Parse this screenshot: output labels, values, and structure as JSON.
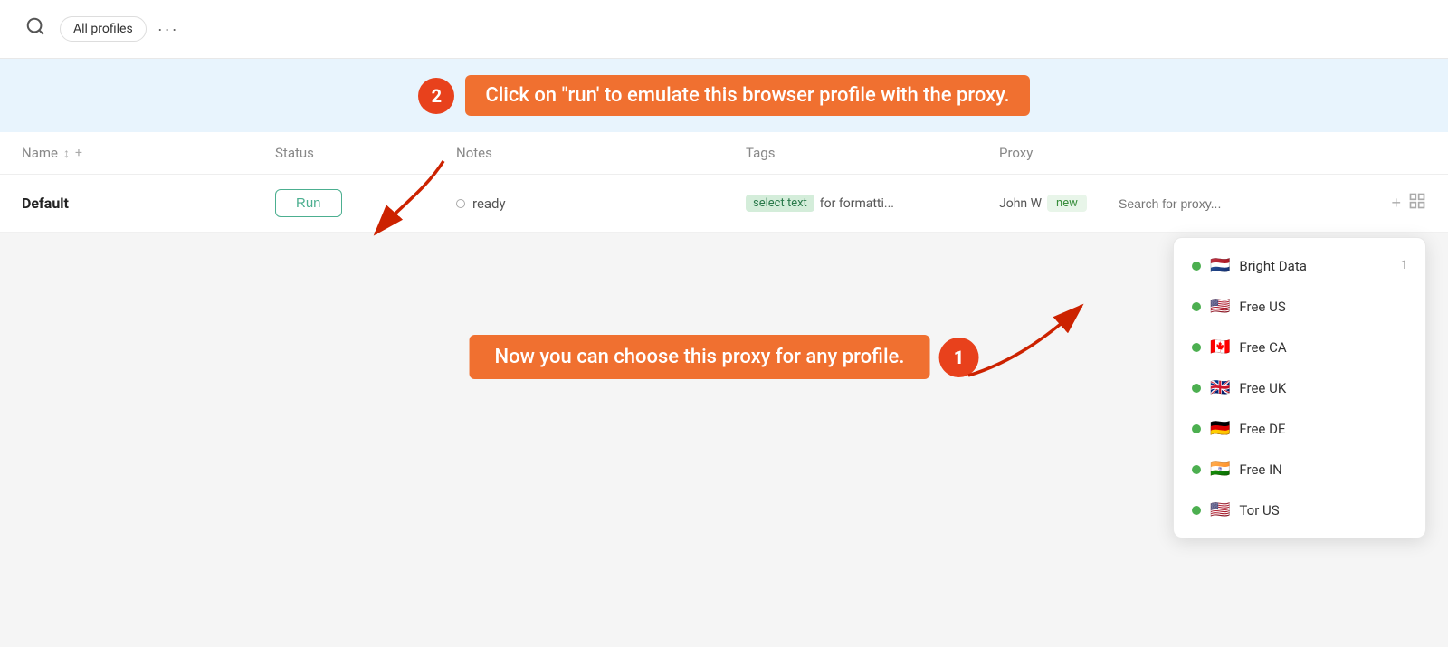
{
  "topbar": {
    "profile_label": "All profiles",
    "more_label": "···"
  },
  "instruction_banner_top": {
    "badge": "2",
    "text": "Click on \"run' to emulate this browser profile with the proxy."
  },
  "table": {
    "headers": {
      "name": "Name",
      "status": "Status",
      "notes": "Notes",
      "tags": "Tags",
      "proxy": "Proxy"
    },
    "row": {
      "name": "Default",
      "run_label": "Run",
      "status": "ready",
      "notes_highlight": "select text",
      "notes_rest": "for formatti...",
      "tag1": "John W",
      "tag2": "new",
      "proxy_placeholder": "Search for proxy..."
    }
  },
  "proxy_dropdown": {
    "items": [
      {
        "name": "Bright Data",
        "flag": "🇳🇱",
        "count": "1"
      },
      {
        "name": "Free US",
        "flag": "🇺🇸",
        "count": ""
      },
      {
        "name": "Free CA",
        "flag": "🇨🇦",
        "count": ""
      },
      {
        "name": "Free UK",
        "flag": "🇬🇧",
        "count": ""
      },
      {
        "name": "Free DE",
        "flag": "🇩🇪",
        "count": ""
      },
      {
        "name": "Free IN",
        "flag": "🇮🇳",
        "count": ""
      },
      {
        "name": "Tor US",
        "flag": "🇺🇸",
        "count": ""
      }
    ]
  },
  "instruction_banner_bottom": {
    "badge": "1",
    "text": "Now you can choose this proxy for any profile."
  },
  "icons": {
    "search": "🔍",
    "sort": "↕",
    "add": "+",
    "proxy_add": "+",
    "proxy_list": "⊞"
  }
}
